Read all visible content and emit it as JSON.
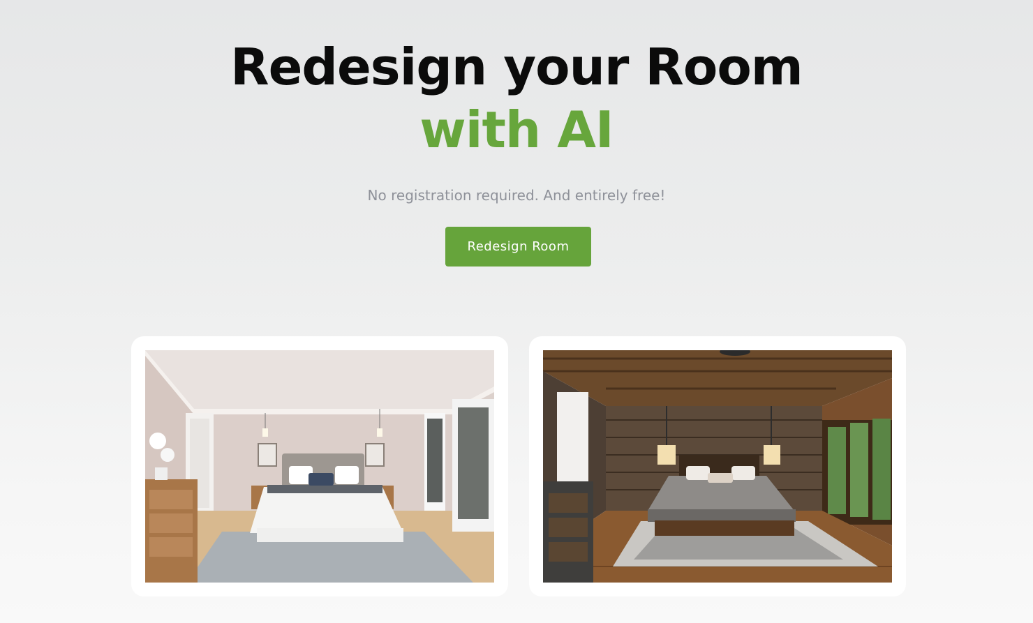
{
  "hero": {
    "title_line1": "Redesign your Room",
    "title_line2": "with AI",
    "accent_color": "#67a63c",
    "subtitle": "No registration required. And entirely free!",
    "cta_label": "Redesign Room",
    "cta_color": "#66a43b"
  },
  "gallery": {
    "images": [
      {
        "description": "original-bedroom-photo"
      },
      {
        "description": "rustic-redesigned-bedroom-photo"
      }
    ]
  }
}
